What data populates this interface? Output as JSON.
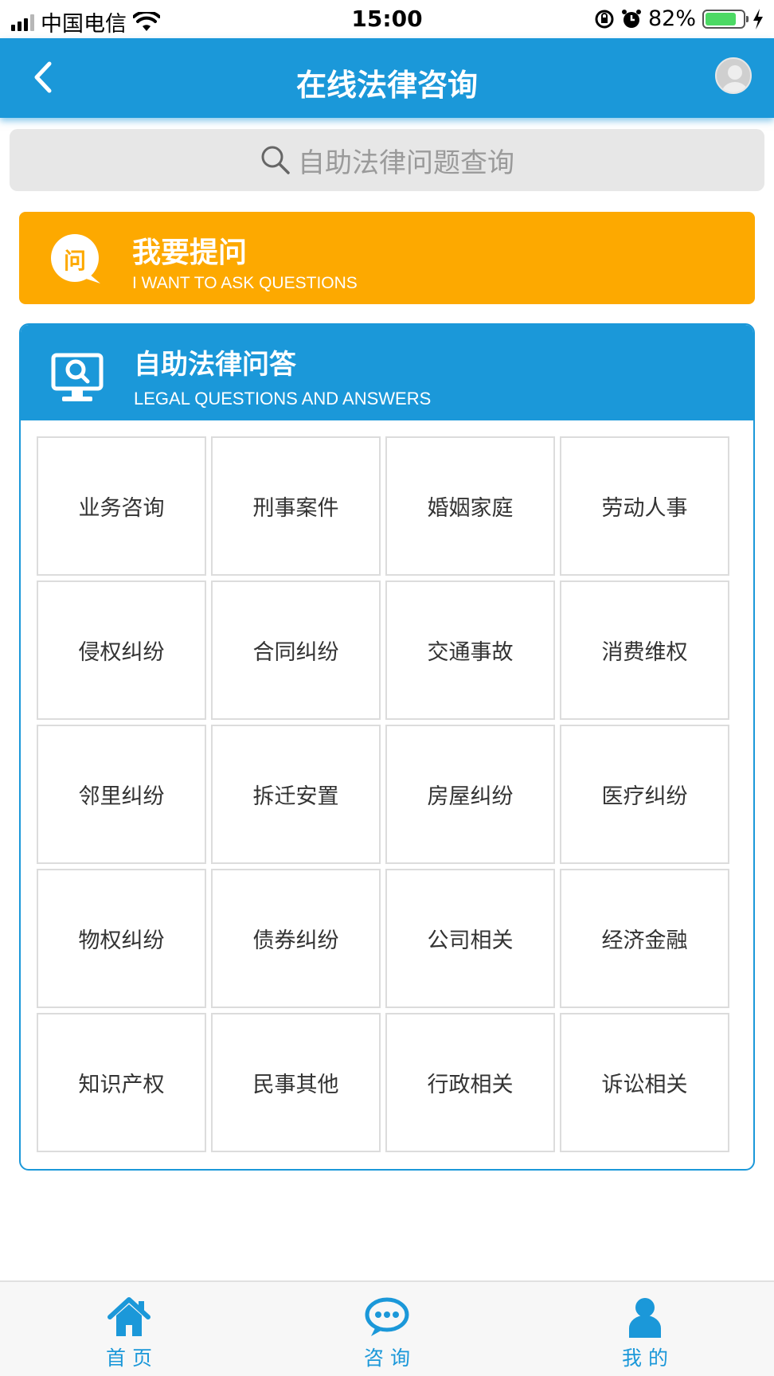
{
  "status_bar": {
    "carrier": "中国电信",
    "time": "15:00",
    "battery": "82%",
    "battery_level": 0.82
  },
  "header": {
    "title": "在线法律咨询",
    "back_icon": "chevron-left-icon",
    "avatar_icon": "user-avatar-icon"
  },
  "search": {
    "placeholder": "自助法律问题查询",
    "icon": "search-icon"
  },
  "ask_banner": {
    "title": "我要提问",
    "subtitle": "I WANT TO ASK QUESTIONS",
    "badge_char": "问",
    "color": "#fda900"
  },
  "qa_section": {
    "title": "自助法律问答",
    "subtitle": "LEGAL QUESTIONS AND ANSWERS",
    "icon": "monitor-search-icon",
    "color": "#1b98d9",
    "categories": [
      "业务咨询",
      "刑事案件",
      "婚姻家庭",
      "劳动人事",
      "侵权纠纷",
      "合同纠纷",
      "交通事故",
      "消费维权",
      "邻里纠纷",
      "拆迁安置",
      "房屋纠纷",
      "医疗纠纷",
      "物权纠纷",
      "债券纠纷",
      "公司相关",
      "经济金融",
      "知识产权",
      "民事其他",
      "行政相关",
      "诉讼相关"
    ]
  },
  "tab_bar": {
    "tabs": [
      {
        "label": "首 页",
        "icon": "home-icon"
      },
      {
        "label": "咨 询",
        "icon": "chat-bubble-icon"
      },
      {
        "label": "我 的",
        "icon": "user-icon"
      }
    ]
  }
}
